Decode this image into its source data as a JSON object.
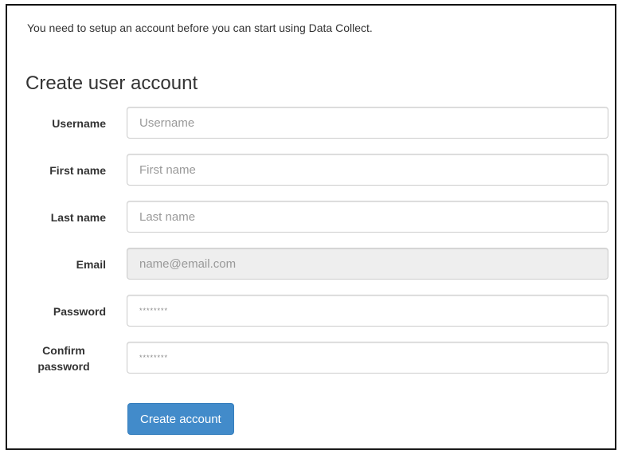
{
  "intro_text": "You need to setup an account before you can start using Data Collect.",
  "form": {
    "title": "Create user account",
    "fields": {
      "username": {
        "label": "Username",
        "placeholder": "Username",
        "value": ""
      },
      "first_name": {
        "label": "First name",
        "placeholder": "First name",
        "value": ""
      },
      "last_name": {
        "label": "Last name",
        "placeholder": "Last name",
        "value": ""
      },
      "email": {
        "label": "Email",
        "placeholder": "",
        "value": "name@email.com",
        "disabled": true
      },
      "password": {
        "label": "Password",
        "placeholder": "",
        "value": "********"
      },
      "confirm_password": {
        "label_line1": "Confirm",
        "label_line2": "password",
        "placeholder": "",
        "value": "********"
      }
    },
    "submit_label": "Create account"
  },
  "colors": {
    "primary_button": "#428bca",
    "text": "#333333",
    "border": "#cccccc",
    "disabled_field_bg": "#eeeeee"
  }
}
